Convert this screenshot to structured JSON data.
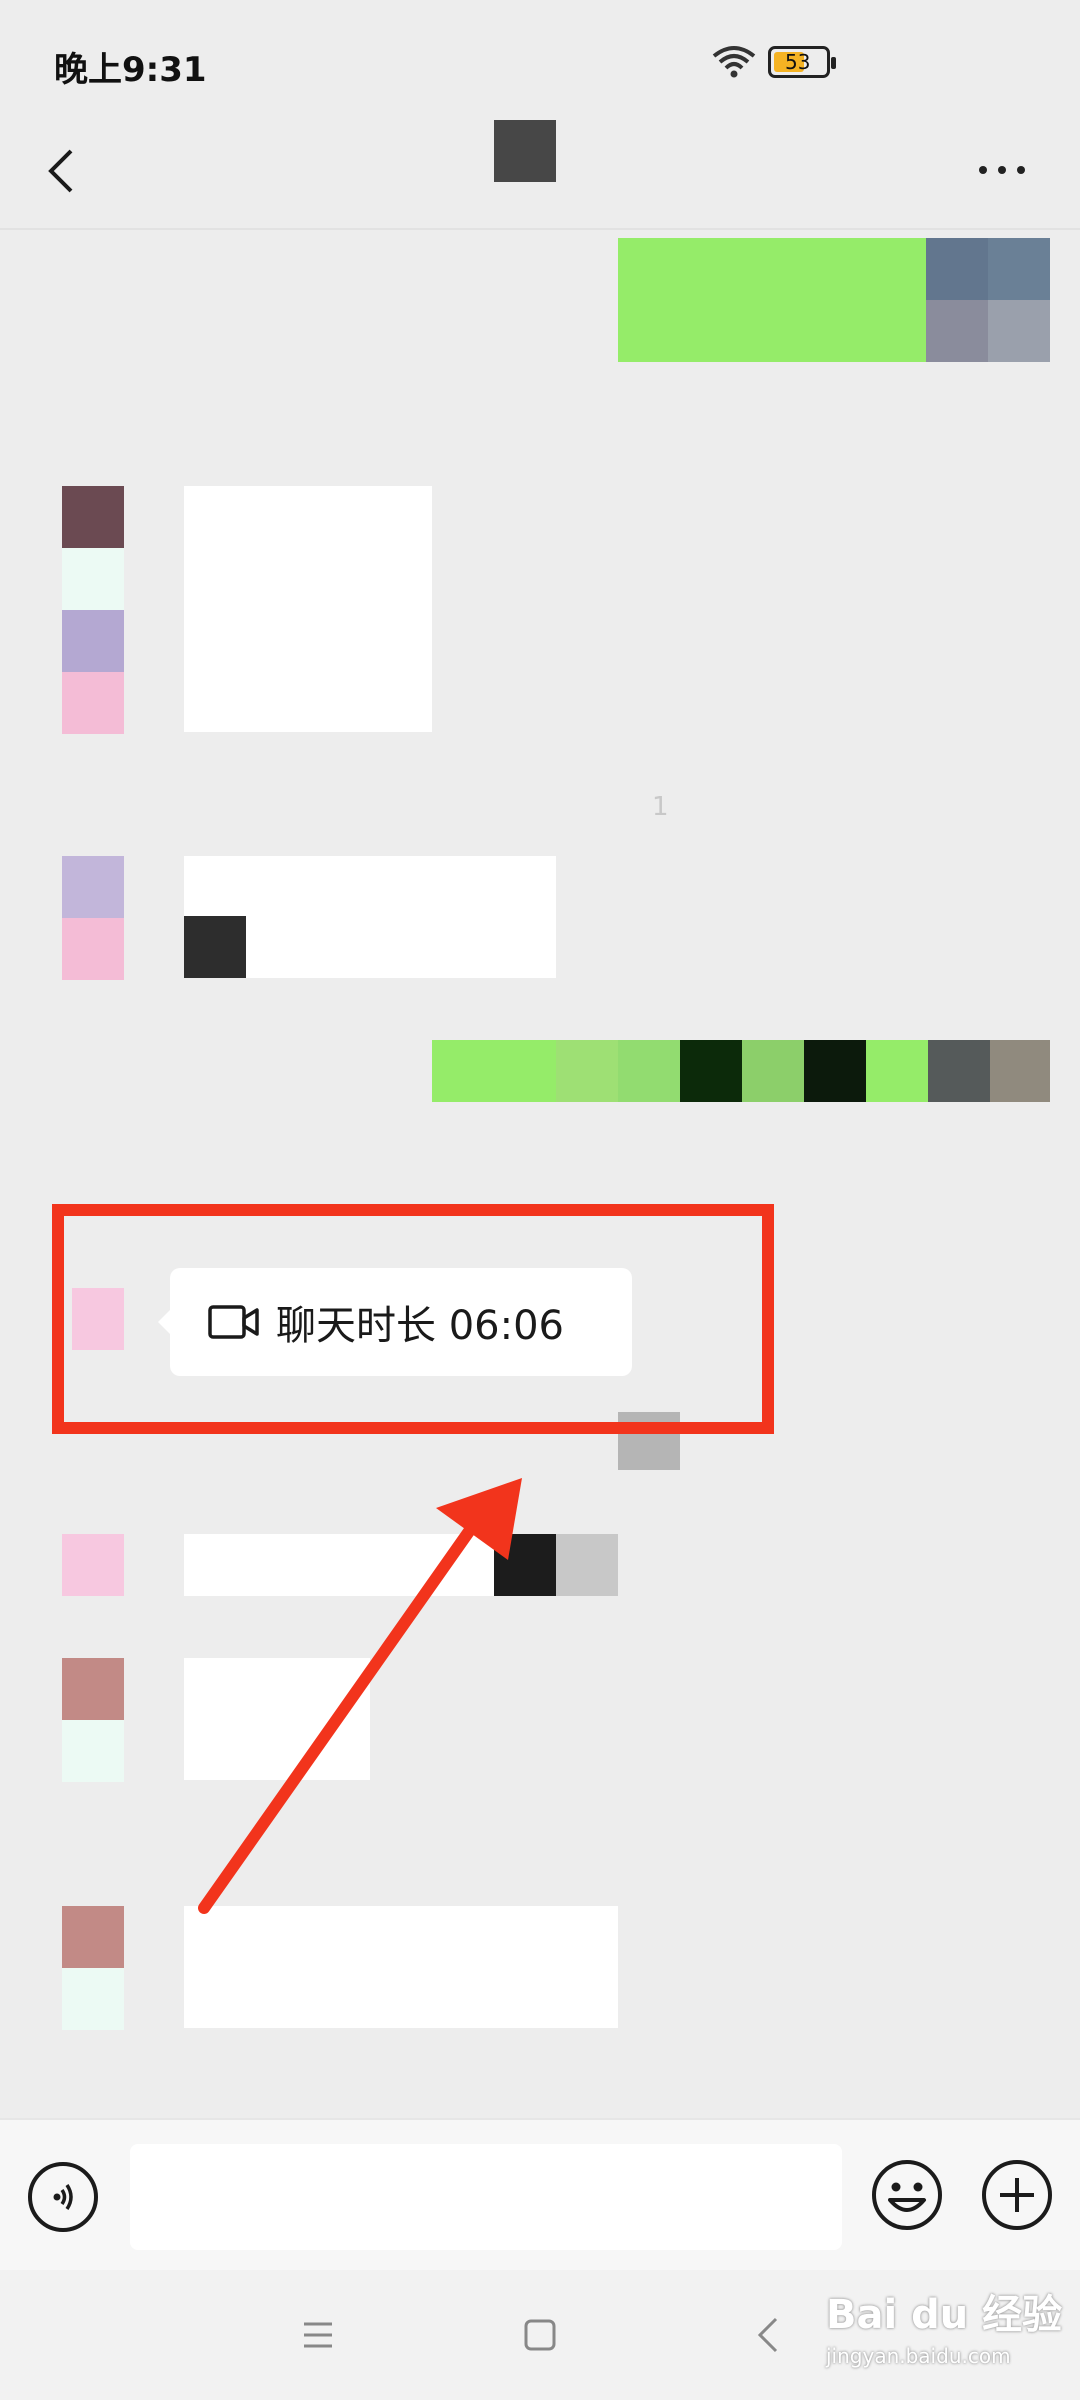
{
  "status_bar": {
    "time": "晚上9:31",
    "battery_level": "53",
    "icons": [
      "wifi-icon",
      "battery-icon"
    ]
  },
  "header": {
    "icons": [
      "back-arrow-icon",
      "more-dots-icon"
    ]
  },
  "messages": {
    "video_call": {
      "label": "聊天时长 06:06",
      "icon": "video-camera-icon"
    },
    "small_mark": "1"
  },
  "input_bar": {
    "value": "",
    "icons": [
      "voice-icon",
      "emoji-icon",
      "plus-icon"
    ]
  },
  "nav_bar": {
    "icons": [
      "menu-icon",
      "home-icon",
      "back-icon"
    ]
  },
  "watermark": {
    "brand": "Bai du 经验",
    "url": "jingyan.baidu.com"
  },
  "colors": {
    "background": "#ededed",
    "my_bubble": "#95ec69",
    "their_bubble": "#ffffff",
    "highlight": "#f2341c"
  }
}
